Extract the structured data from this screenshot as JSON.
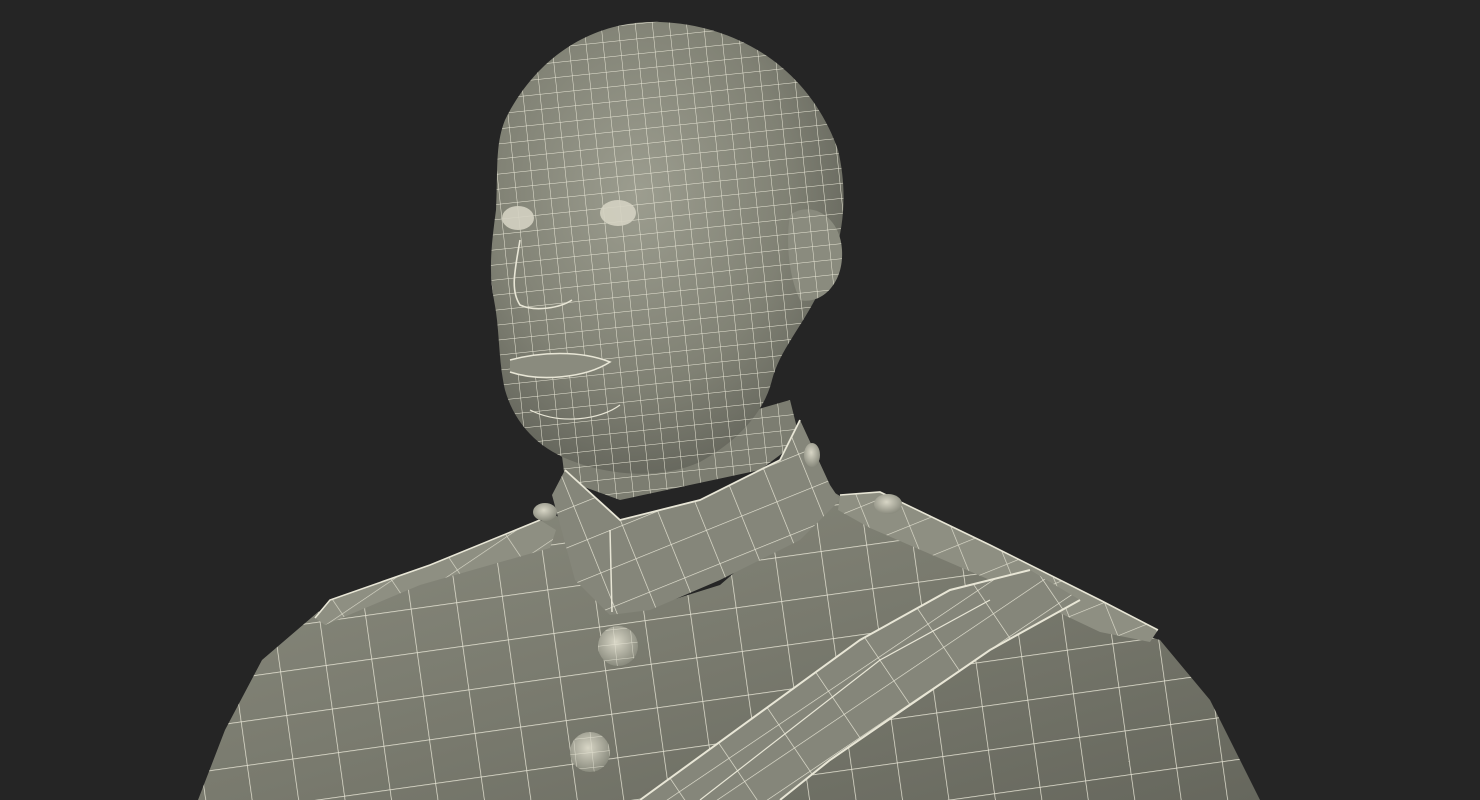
{
  "scene": {
    "subject": "wireframe-bust",
    "colors": {
      "background": "#252525",
      "surface": "#7a7b6f",
      "surface_light": "#9a9b8d",
      "surface_dark": "#5a5b52",
      "wire": "#e8e6d6"
    }
  }
}
